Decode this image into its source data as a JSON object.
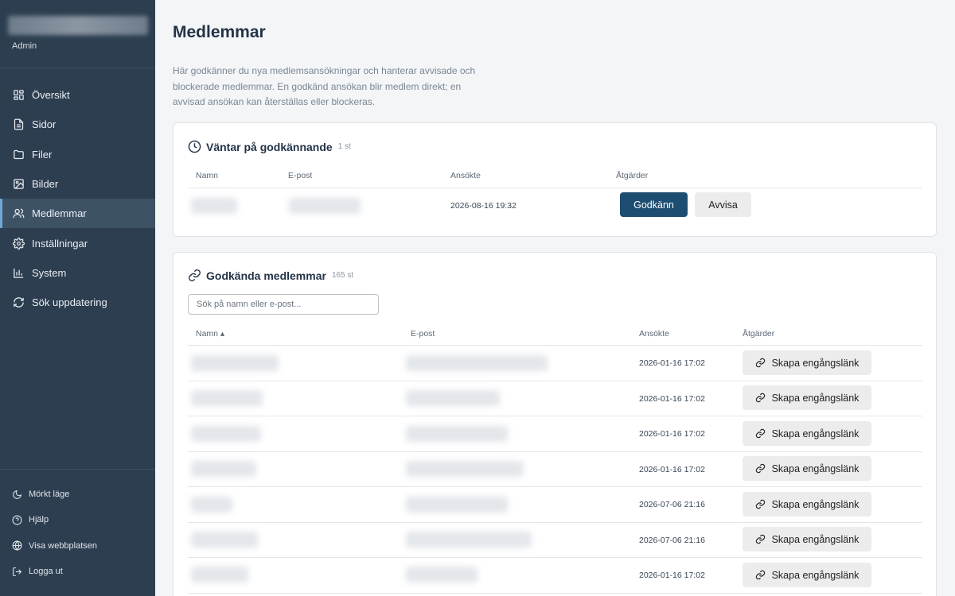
{
  "sidebar": {
    "role": "Admin",
    "items": [
      {
        "label": "Översikt",
        "icon": "grid-icon"
      },
      {
        "label": "Sidor",
        "icon": "document-icon"
      },
      {
        "label": "Filer",
        "icon": "folder-icon"
      },
      {
        "label": "Bilder",
        "icon": "image-icon"
      },
      {
        "label": "Medlemmar",
        "icon": "users-icon",
        "active": true
      },
      {
        "label": "Inställningar",
        "icon": "gear-icon"
      },
      {
        "label": "System",
        "icon": "bar-chart-icon"
      },
      {
        "label": "Sök uppdatering",
        "icon": "refresh-icon"
      }
    ],
    "bottom": [
      {
        "label": "Mörkt läge",
        "icon": "moon-icon"
      },
      {
        "label": "Hjälp",
        "icon": "help-icon"
      },
      {
        "label": "Visa webbplatsen",
        "icon": "globe-icon"
      },
      {
        "label": "Logga ut",
        "icon": "logout-icon"
      }
    ]
  },
  "page": {
    "title": "Medlemmar",
    "intro": "Här godkänner du nya medlemsansökningar och hanterar avvisade och blockerade medlemmar. En godkänd ansökan blir medlem direkt; en avvisad ansökan kan återställas eller blockeras."
  },
  "pending": {
    "title": "Väntar på godkännande",
    "count": "1 st",
    "columns": [
      "Namn",
      "E-post",
      "Ansökte",
      "Åtgärder"
    ],
    "rows": [
      {
        "applied": "2026-08-16 19:32"
      }
    ],
    "approve_label": "Godkänn",
    "reject_label": "Avvisa"
  },
  "approved": {
    "title": "Godkända medlemmar",
    "count": "165 st",
    "search_placeholder": "Sök på namn eller e-post...",
    "columns": [
      "Namn ▴",
      "E-post",
      "Ansökte",
      "Åtgärder"
    ],
    "link_label": "Skapa engångslänk",
    "rows": [
      {
        "applied": "2026-01-16 17:02"
      },
      {
        "applied": "2026-01-16 17:02"
      },
      {
        "applied": "2026-01-16 17:02"
      },
      {
        "applied": "2026-01-16 17:02"
      },
      {
        "applied": "2026-07-06 21:16"
      },
      {
        "applied": "2026-07-06 21:16"
      },
      {
        "applied": "2026-01-16 17:02"
      }
    ]
  },
  "colors": {
    "sidebar": "#2d3e50",
    "primary": "#1e4d72",
    "active_bar": "#6ea8d8"
  }
}
